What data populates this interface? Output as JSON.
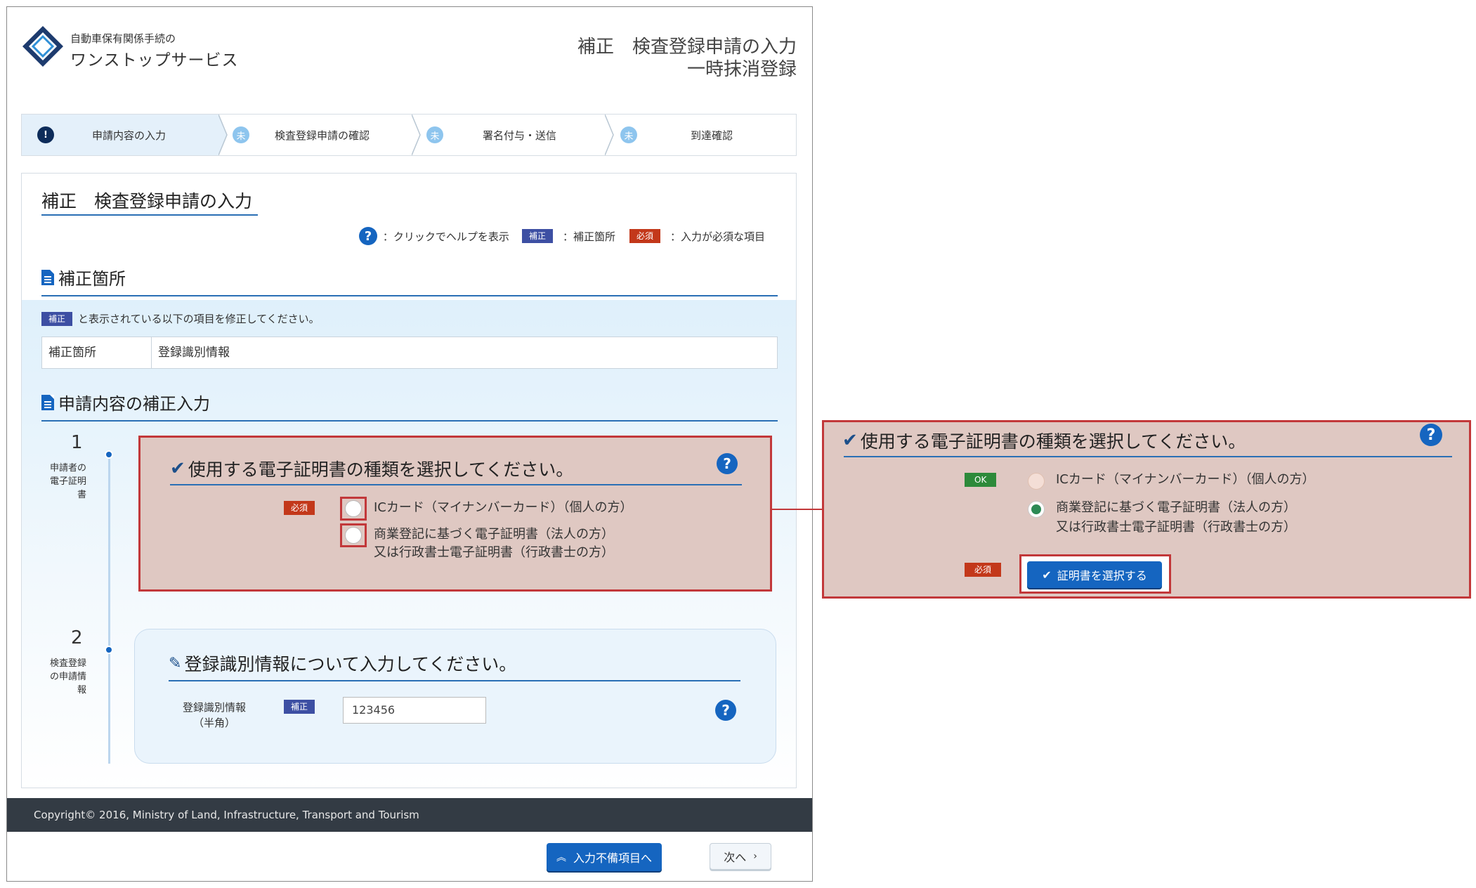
{
  "header": {
    "logo_line1": "自動車保有関係手続の",
    "logo_line2": "ワンストップサービス",
    "title_line1": "補正　検査登録申請の入力",
    "title_line2": "一時抹消登録"
  },
  "steps": [
    {
      "icon": "!",
      "label": "申請内容の入力",
      "state": "active"
    },
    {
      "icon": "未",
      "label": "検査登録申請の確認",
      "state": "pending"
    },
    {
      "icon": "未",
      "label": "署名付与・送信",
      "state": "pending"
    },
    {
      "icon": "未",
      "label": "到達確認",
      "state": "pending"
    }
  ],
  "page": {
    "title": "補正　検査登録申請の入力",
    "legend_help": "：クリックでヘルプを表示",
    "legend_hosei_badge": "補正",
    "legend_hosei_text": "：補正箇所",
    "legend_hissu_badge": "必須",
    "legend_hissu_text": "：入力が必須な項目"
  },
  "correction_section": {
    "title": "補正箇所",
    "note_badge": "補正",
    "note_text": "と表示されている以下の項目を修正してください。",
    "table_header": "補正箇所",
    "table_value": "登録識別情報"
  },
  "input_section": {
    "title": "申請内容の補正入力",
    "step1": {
      "number": "1",
      "desc_line1": "申請者の",
      "desc_line2": "電子証明",
      "desc_line3": "書",
      "card_title": "使用する電子証明書の種類を選択してください。",
      "badge": "必須",
      "option1": "ICカード（マイナンバーカード）（個人の方）",
      "option2_line1": "商業登記に基づく電子証明書（法人の方）",
      "option2_line2": "又は行政書士電子証明書（行政書士の方）"
    },
    "step2": {
      "number": "2",
      "desc_line1": "検査登録",
      "desc_line2": "の申請情",
      "desc_line3": "報",
      "card_title": "登録識別情報について入力してください。",
      "field_label_line1": "登録識別情報",
      "field_label_line2": "（半角）",
      "badge": "補正",
      "field_value": "123456"
    }
  },
  "footer": {
    "copyright": "Copyright© 2016, Ministry of Land, Infrastructure, Transport and Tourism"
  },
  "buttons": {
    "back_to_errors": "入力不備項目へ",
    "next": "次へ"
  },
  "zoom_panel": {
    "title": "使用する電子証明書の種類を選択してください。",
    "ok_badge": "OK",
    "option1": "ICカード（マイナンバーカード）（個人の方）",
    "option2_line1": "商業登記に基づく電子証明書（法人の方）",
    "option2_line2": "又は行政書士電子証明書（行政書士の方）",
    "selected_option": 2,
    "hissu_badge": "必須",
    "select_cert_button": "証明書を選択する"
  },
  "colors": {
    "primary": "#1565c0",
    "highlight_border": "#c2383a",
    "highlight_fill": "#dfc8c2",
    "hosei_badge": "#3d4fa3",
    "hissu_badge": "#c3381a",
    "ok_badge": "#2d8a3a",
    "footer_bg": "#333b44"
  }
}
